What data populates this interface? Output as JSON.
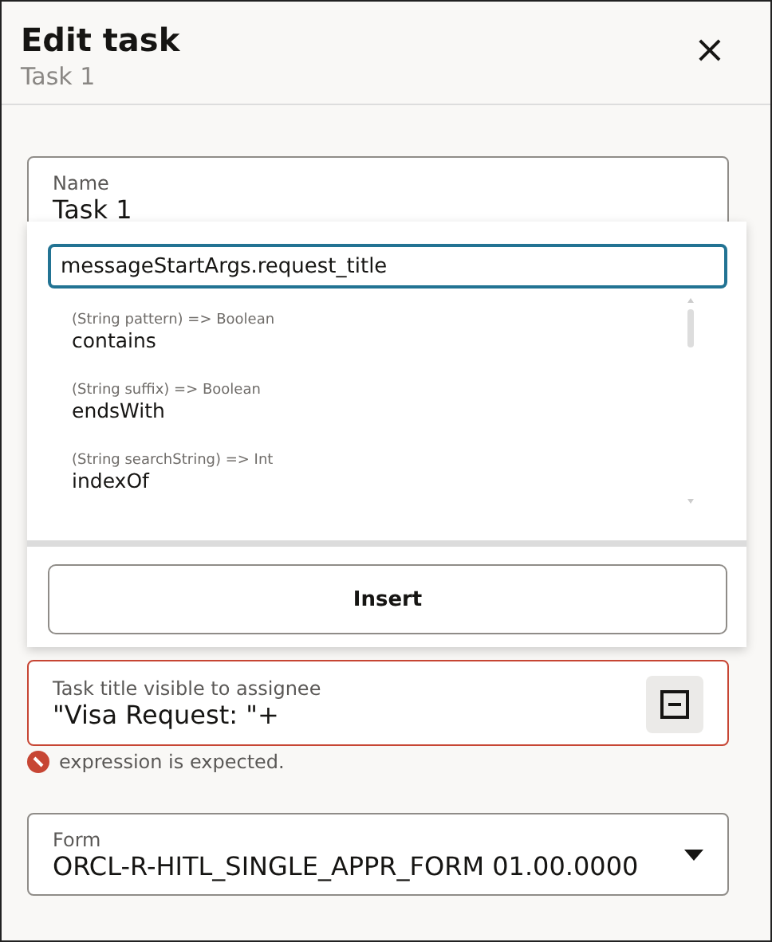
{
  "header": {
    "title": "Edit task",
    "subtitle": "Task 1",
    "close_icon": "×"
  },
  "name_field": {
    "label": "Name",
    "value": "Task 1"
  },
  "expression_popup": {
    "input_value": "messageStartArgs.request_title",
    "suggestions": [
      {
        "signature": "(String pattern) => Boolean",
        "name": "contains"
      },
      {
        "signature": "(String suffix) => Boolean",
        "name": "endsWith"
      },
      {
        "signature": "(String searchString) => Int",
        "name": "indexOf"
      }
    ],
    "insert_button": "Insert"
  },
  "task_title_field": {
    "label": "Task title visible to assignee",
    "value": "\"Visa Request: \"+",
    "invalid": true,
    "error": "expression is expected."
  },
  "form_field": {
    "label": "Form",
    "value": "ORCL-R-HITL_SINGLE_APPR_FORM 01.00.0000"
  }
}
